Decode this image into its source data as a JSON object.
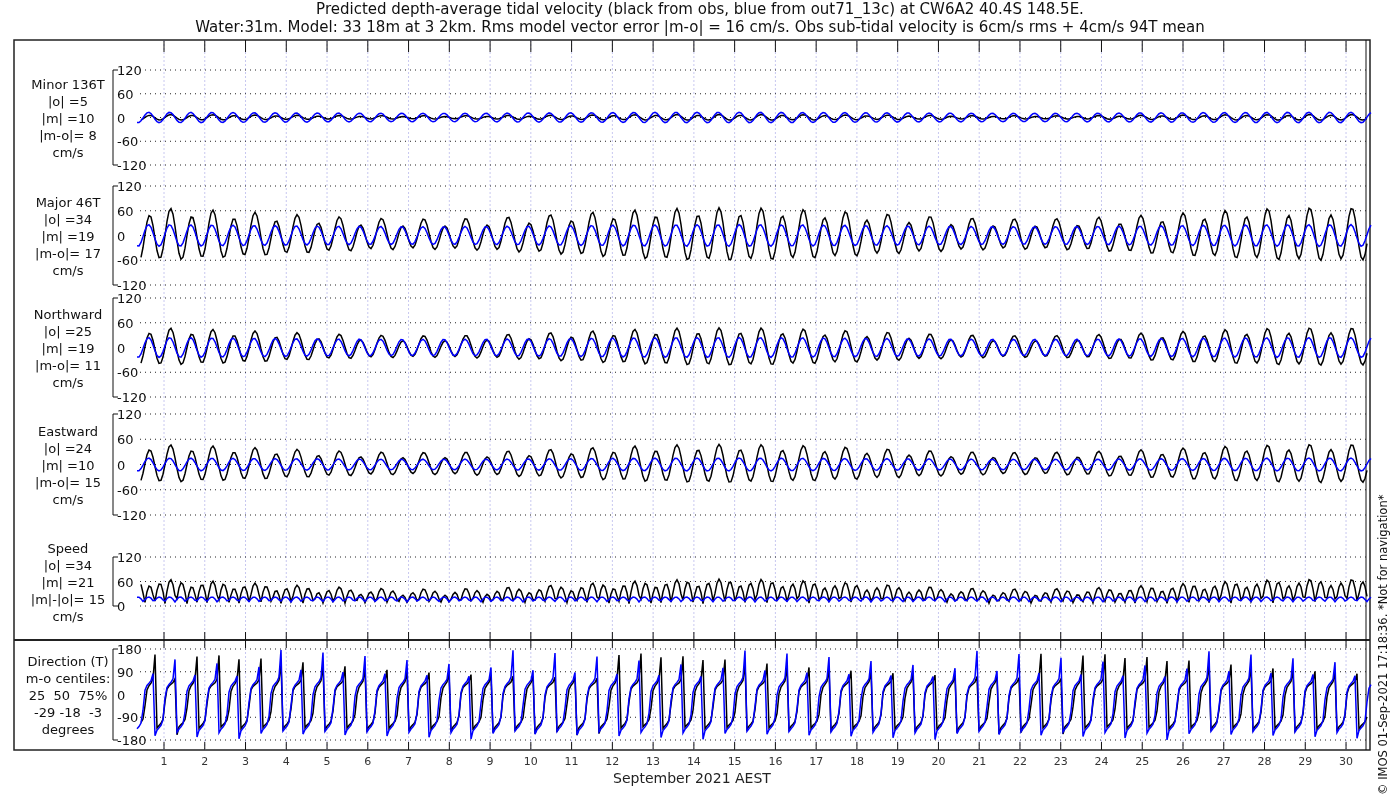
{
  "figure": {
    "title": "Predicted depth-average tidal velocity (black from obs, blue from out71_13c) at CW6A2 40.4S 148.5E.",
    "subtitle": "Water:31m. Model: 33 18m at 3 2km. Rms model vector error |m-o| = 16 cm/s. Obs sub-tidal velocity is 6cm/s rms + 4cm/s 94T mean",
    "panels": [
      {
        "kind": "velocity",
        "label_lines": [
          "Minor 136T",
          "|o| =5",
          "|m| =10",
          "|m-o|= 8",
          "cm/s"
        ],
        "yticks": [
          "120",
          "60",
          "0",
          "-60",
          "-120"
        ],
        "series": [
          {
            "color": "#000000"
          },
          {
            "color": "#0000ff"
          }
        ]
      },
      {
        "kind": "velocity",
        "label_lines": [
          "Major 46T",
          "|o| =34",
          "|m| =19",
          "|m-o|= 17",
          "cm/s"
        ],
        "yticks": [
          "120",
          "60",
          "0",
          "-60",
          "-120"
        ],
        "series": [
          {
            "color": "#000000"
          },
          {
            "color": "#0000ff"
          }
        ]
      },
      {
        "kind": "velocity",
        "label_lines": [
          "Northward",
          "|o| =25",
          "|m| =19",
          "|m-o|= 11",
          "cm/s"
        ],
        "yticks": [
          "120",
          "60",
          "0",
          "-60",
          "-120"
        ],
        "series": [
          {
            "color": "#000000"
          },
          {
            "color": "#0000ff"
          }
        ]
      },
      {
        "kind": "velocity",
        "label_lines": [
          "Eastward",
          "|o| =24",
          "|m| =10",
          "|m-o|= 15",
          "cm/s"
        ],
        "yticks": [
          "120",
          "60",
          "0",
          "-60",
          "-120"
        ],
        "series": [
          {
            "color": "#000000"
          },
          {
            "color": "#0000ff"
          }
        ]
      },
      {
        "kind": "speed",
        "label_lines": [
          "Speed",
          "|o| =34",
          "|m| =21",
          "|m|-|o|= 15",
          "cm/s"
        ],
        "yticks": [
          "120",
          "60",
          "0"
        ],
        "series": [
          {
            "color": "#000000"
          },
          {
            "color": "#0000ff"
          }
        ]
      },
      {
        "kind": "direction",
        "label_lines": [
          "Direction (T)",
          "m-o centiles:",
          "25  50  75%",
          "-29 -18  -3",
          "degrees"
        ],
        "yticks": [
          "180",
          "90",
          "0",
          "-90",
          "-180"
        ],
        "series": [
          {
            "color": "#000000"
          },
          {
            "color": "#0000ff"
          }
        ]
      }
    ],
    "x_axis": {
      "day_labels": [
        "1",
        "2",
        "3",
        "4",
        "5",
        "6",
        "7",
        "8",
        "9",
        "10",
        "11",
        "12",
        "13",
        "14",
        "15",
        "16",
        "17",
        "18",
        "19",
        "20",
        "21",
        "22",
        "23",
        "24",
        "25",
        "26",
        "27",
        "28",
        "29",
        "30"
      ],
      "title": "September 2021 AEST"
    },
    "footer": "© IMOS 01-Sep-2021 17:18:36. *Not for navigation*"
  }
}
